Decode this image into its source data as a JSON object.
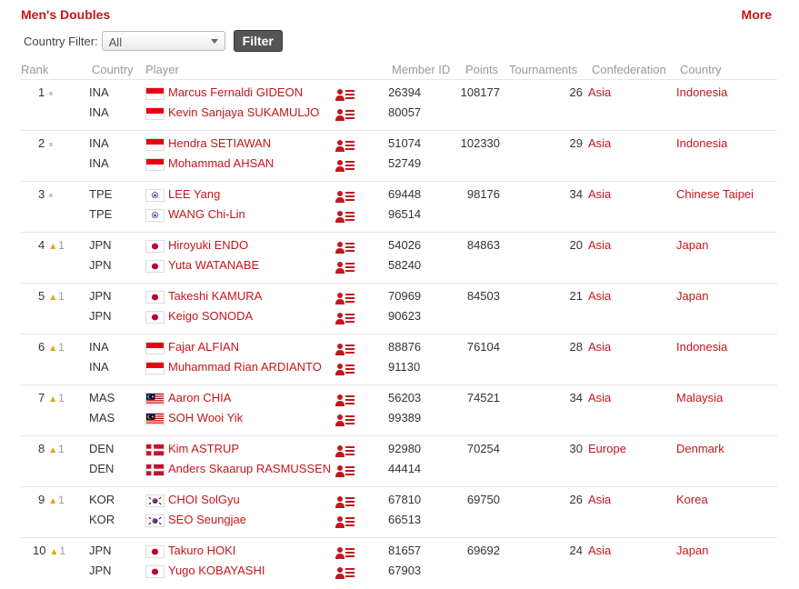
{
  "header": {
    "title": "Men's Doubles",
    "more": "More"
  },
  "filter": {
    "label": "Country Filter:",
    "selected": "All",
    "button": "Filter"
  },
  "columns": {
    "rank": "Rank",
    "country": "Country",
    "player": "Player",
    "member_id": "Member ID",
    "points": "Points",
    "tournaments": "Tournaments",
    "confederation": "Confederation",
    "country_name": "Country"
  },
  "rows": [
    {
      "rank": "1",
      "change": "",
      "move": "none",
      "points": "108177",
      "tournaments": "26",
      "confederation": "Asia",
      "country": "Indonesia",
      "players": [
        {
          "code": "INA",
          "flag": "INA",
          "name": "Marcus Fernaldi GIDEON",
          "member_id": "26394"
        },
        {
          "code": "INA",
          "flag": "INA",
          "name": "Kevin Sanjaya SUKAMULJO",
          "member_id": "80057"
        }
      ]
    },
    {
      "rank": "2",
      "change": "",
      "move": "none",
      "points": "102330",
      "tournaments": "29",
      "confederation": "Asia",
      "country": "Indonesia",
      "players": [
        {
          "code": "INA",
          "flag": "INA",
          "name": "Hendra SETIAWAN",
          "member_id": "51074"
        },
        {
          "code": "INA",
          "flag": "INA",
          "name": "Mohammad AHSAN",
          "member_id": "52749"
        }
      ]
    },
    {
      "rank": "3",
      "change": "",
      "move": "none",
      "points": "98176",
      "tournaments": "34",
      "confederation": "Asia",
      "country": "Chinese Taipei",
      "players": [
        {
          "code": "TPE",
          "flag": "TPE",
          "name": "LEE Yang",
          "member_id": "69448"
        },
        {
          "code": "TPE",
          "flag": "TPE",
          "name": "WANG Chi-Lin",
          "member_id": "96514"
        }
      ]
    },
    {
      "rank": "4",
      "change": "1",
      "move": "up",
      "points": "84863",
      "tournaments": "20",
      "confederation": "Asia",
      "country": "Japan",
      "players": [
        {
          "code": "JPN",
          "flag": "JPN",
          "name": "Hiroyuki ENDO",
          "member_id": "54026"
        },
        {
          "code": "JPN",
          "flag": "JPN",
          "name": "Yuta WATANABE",
          "member_id": "58240"
        }
      ]
    },
    {
      "rank": "5",
      "change": "1",
      "move": "up",
      "points": "84503",
      "tournaments": "21",
      "confederation": "Asia",
      "country": "Japan",
      "players": [
        {
          "code": "JPN",
          "flag": "JPN",
          "name": "Takeshi KAMURA",
          "member_id": "70969"
        },
        {
          "code": "JPN",
          "flag": "JPN",
          "name": "Keigo SONODA",
          "member_id": "90623"
        }
      ]
    },
    {
      "rank": "6",
      "change": "1",
      "move": "up",
      "points": "76104",
      "tournaments": "28",
      "confederation": "Asia",
      "country": "Indonesia",
      "players": [
        {
          "code": "INA",
          "flag": "INA",
          "name": "Fajar ALFIAN",
          "member_id": "88876"
        },
        {
          "code": "INA",
          "flag": "INA",
          "name": "Muhammad Rian ARDIANTO",
          "member_id": "91130"
        }
      ]
    },
    {
      "rank": "7",
      "change": "1",
      "move": "up",
      "points": "74521",
      "tournaments": "34",
      "confederation": "Asia",
      "country": "Malaysia",
      "players": [
        {
          "code": "MAS",
          "flag": "MAS",
          "name": "Aaron CHIA",
          "member_id": "56203"
        },
        {
          "code": "MAS",
          "flag": "MAS",
          "name": "SOH Wooi Yik",
          "member_id": "99389"
        }
      ]
    },
    {
      "rank": "8",
      "change": "1",
      "move": "up",
      "points": "70254",
      "tournaments": "30",
      "confederation": "Europe",
      "country": "Denmark",
      "players": [
        {
          "code": "DEN",
          "flag": "DEN",
          "name": "Kim ASTRUP",
          "member_id": "92980"
        },
        {
          "code": "DEN",
          "flag": "DEN",
          "name": "Anders Skaarup RASMUSSEN",
          "member_id": "44414"
        }
      ]
    },
    {
      "rank": "9",
      "change": "1",
      "move": "up",
      "points": "69750",
      "tournaments": "26",
      "confederation": "Asia",
      "country": "Korea",
      "players": [
        {
          "code": "KOR",
          "flag": "KOR",
          "name": "CHOI SolGyu",
          "member_id": "67810"
        },
        {
          "code": "KOR",
          "flag": "KOR",
          "name": "SEO Seungjae",
          "member_id": "66513"
        }
      ]
    },
    {
      "rank": "10",
      "change": "1",
      "move": "up",
      "points": "69692",
      "tournaments": "24",
      "confederation": "Asia",
      "country": "Japan",
      "players": [
        {
          "code": "JPN",
          "flag": "JPN",
          "name": "Takuro HOKI",
          "member_id": "81657"
        },
        {
          "code": "JPN",
          "flag": "JPN",
          "name": "Yugo KOBAYASHI",
          "member_id": "67903"
        }
      ]
    }
  ],
  "icons": {
    "profile": "player-profile-icon",
    "rank_up": "rank-up-arrow-icon",
    "no_change": "no-change-dot-icon"
  },
  "colors": {
    "accent": "#c4161c",
    "rank_up": "#e8a00a",
    "header_text": "#999999"
  }
}
